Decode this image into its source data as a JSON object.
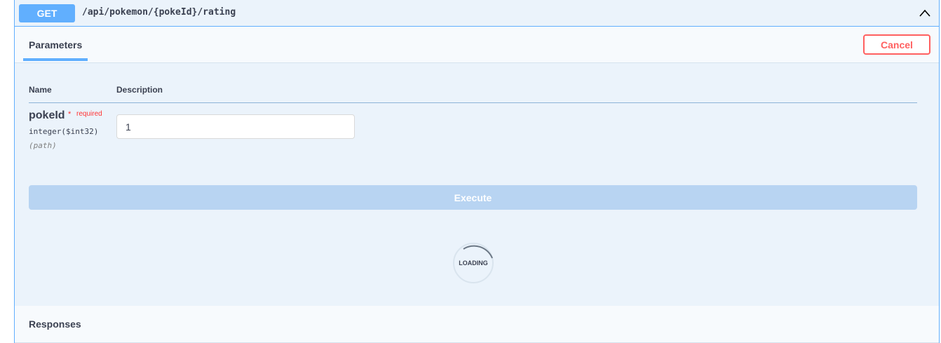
{
  "summary": {
    "method": "GET",
    "path": "/api/pokemon/{pokeId}/rating"
  },
  "tabs": {
    "parameters_label": "Parameters",
    "cancel_label": "Cancel"
  },
  "table": {
    "columns": [
      "Name",
      "Description"
    ]
  },
  "param": {
    "name": "pokeId",
    "required_star": "*",
    "required_label": "required",
    "type": "integer($int32)",
    "location": "(path)",
    "value": "1"
  },
  "execute": {
    "label": "Execute"
  },
  "loading": {
    "label": "LOADING"
  },
  "responses": {
    "title": "Responses"
  },
  "colors": {
    "get_accent": "#61affe",
    "cancel_red": "#ff6060",
    "required_red": "#ff3333",
    "body_bg": "#ebf3fb"
  },
  "icons": {
    "collapse": "chevron-up-icon"
  }
}
